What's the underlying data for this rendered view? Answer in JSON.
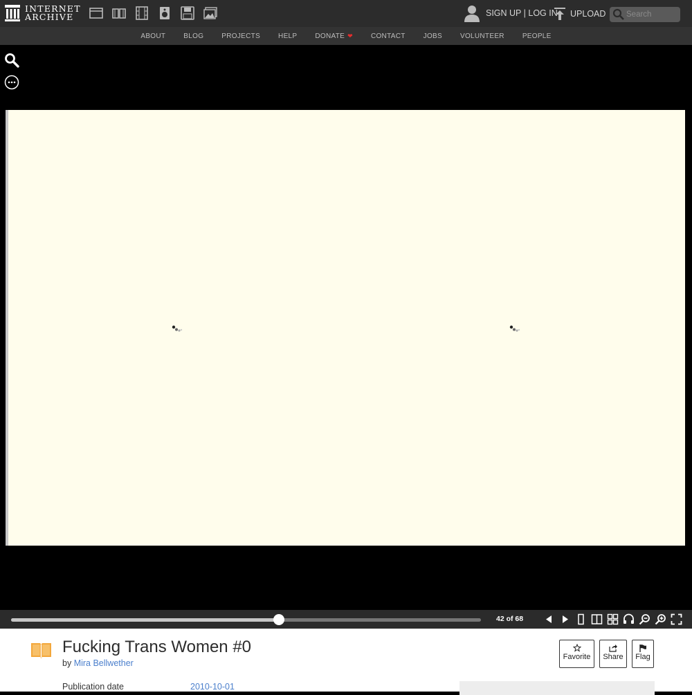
{
  "header": {
    "logo_line1": "INTERNET",
    "logo_line2": "ARCHIVE",
    "auth_text": "SIGN UP | LOG IN",
    "upload_label": "UPLOAD",
    "search_placeholder": "Search",
    "media_icons": [
      "web-icon",
      "texts-icon",
      "video-icon",
      "audio-icon",
      "software-icon",
      "images-icon"
    ]
  },
  "subnav": [
    "ABOUT",
    "BLOG",
    "PROJECTS",
    "HELP",
    "DONATE",
    "CONTACT",
    "JOBS",
    "VOLUNTEER",
    "PEOPLE"
  ],
  "viewer": {
    "page_current": 42,
    "page_total": 68,
    "page_label": "42 of 68",
    "progress_fraction": 0.57
  },
  "item": {
    "title": "Fucking Trans Women #0",
    "by_prefix": "by",
    "author": "Mira Bellwether",
    "pub_label": "Publication date",
    "pub_value": "2010-10-01"
  },
  "actions": {
    "favorite": "Favorite",
    "share": "Share",
    "flag": "Flag"
  },
  "colors": {
    "page_bg": "#fffdec",
    "link": "#4b7fcc",
    "donate_heart": "#e52d2d",
    "book_icon": "#f3a73b"
  }
}
